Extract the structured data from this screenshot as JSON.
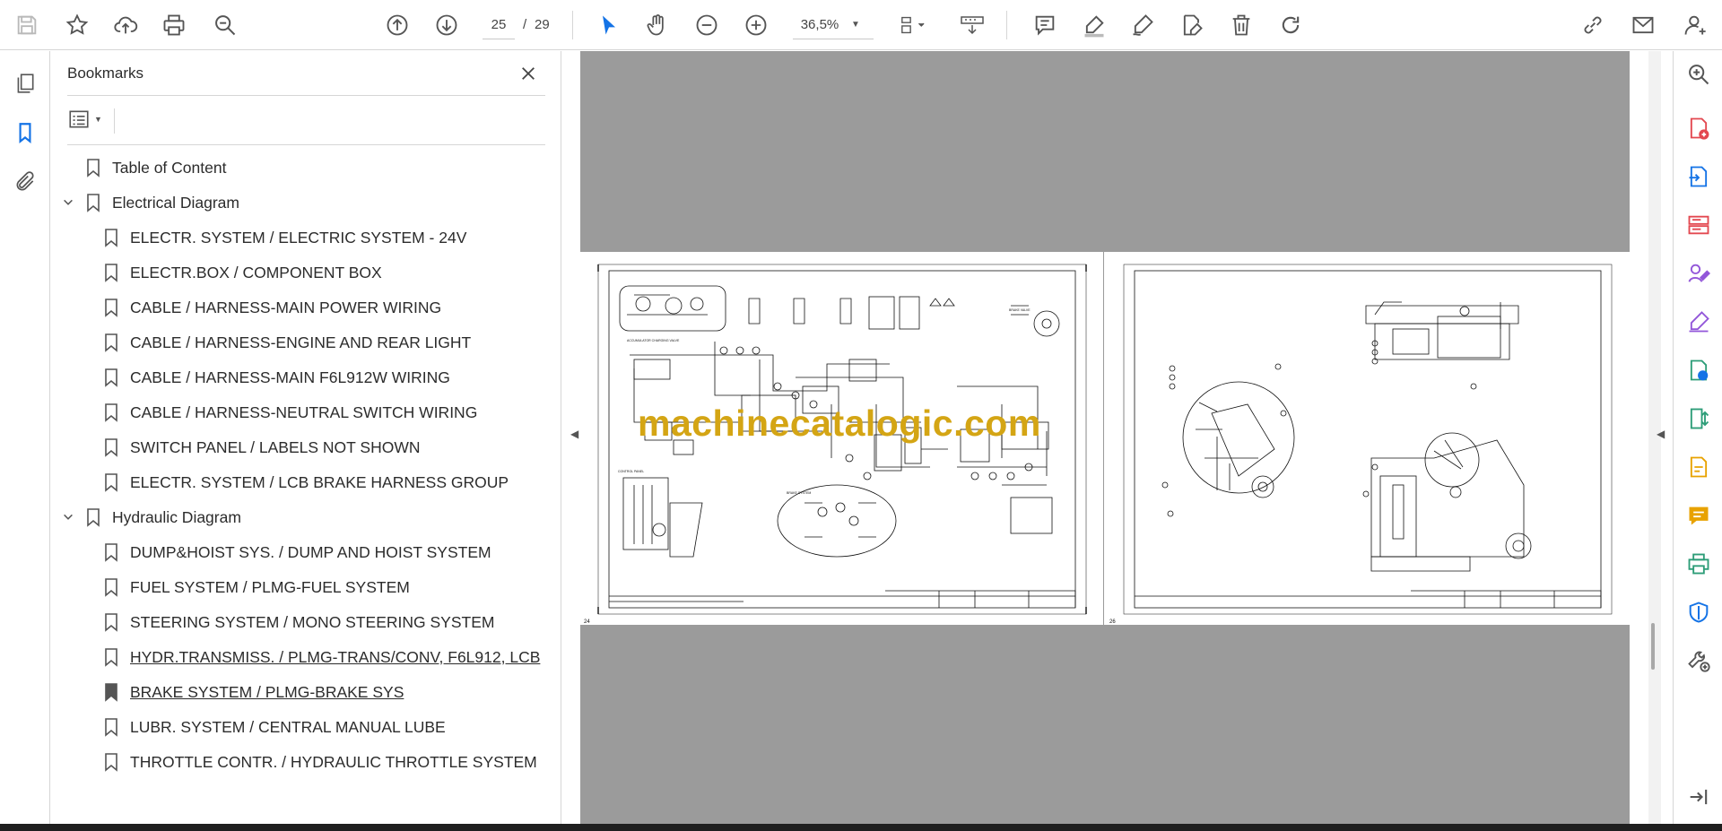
{
  "toolbar": {
    "icons": [
      "save-icon",
      "star-icon",
      "upload-icon",
      "print-icon",
      "search-zoom-icon",
      "arrow-up-circle-icon",
      "arrow-down-circle-icon",
      "select-cursor-icon",
      "hand-icon",
      "zoom-out-icon",
      "zoom-in-icon",
      "page-fit-icon",
      "scroll-mode-icon",
      "comment-icon",
      "highlighter-icon",
      "draw-icon",
      "edit-text-icon",
      "trash-icon",
      "redo-icon",
      "share-link-icon",
      "email-icon",
      "account-icon"
    ],
    "current_page": "25",
    "page_separator": "/",
    "total_pages": "29",
    "zoom": "36,5%"
  },
  "bookmarks": {
    "title": "Bookmarks",
    "items": [
      {
        "label": "Table of Content",
        "level": 0,
        "expandable": false,
        "visited": false
      },
      {
        "label": "Electrical Diagram",
        "level": 0,
        "expandable": true,
        "expanded": true,
        "visited": false
      },
      {
        "label": "ELECTR. SYSTEM / ELECTRIC SYSTEM - 24V",
        "level": 1,
        "visited": false
      },
      {
        "label": "ELECTR.BOX / COMPONENT BOX",
        "level": 1,
        "visited": false
      },
      {
        "label": "CABLE / HARNESS-MAIN POWER WIRING",
        "level": 1,
        "visited": false
      },
      {
        "label": "CABLE / HARNESS-ENGINE AND REAR LIGHT",
        "level": 1,
        "visited": false
      },
      {
        "label": "CABLE / HARNESS-MAIN F6L912W WIRING",
        "level": 1,
        "visited": false
      },
      {
        "label": "CABLE / HARNESS-NEUTRAL SWITCH WIRING",
        "level": 1,
        "visited": false
      },
      {
        "label": "SWITCH PANEL / LABELS NOT SHOWN",
        "level": 1,
        "visited": false
      },
      {
        "label": "ELECTR. SYSTEM / LCB BRAKE HARNESS GROUP",
        "level": 1,
        "visited": false
      },
      {
        "label": "Hydraulic Diagram",
        "level": 0,
        "expandable": true,
        "expanded": true,
        "visited": false
      },
      {
        "label": "DUMP&HOIST SYS. / DUMP AND HOIST SYSTEM",
        "level": 1,
        "visited": false
      },
      {
        "label": "FUEL SYSTEM / PLMG-FUEL SYSTEM",
        "level": 1,
        "visited": false
      },
      {
        "label": "STEERING SYSTEM / MONO STEERING SYSTEM",
        "level": 1,
        "visited": false
      },
      {
        "label": "HYDR.TRANSMISS. / PLMG-TRANS/CONV, F6L912, LCB",
        "level": 1,
        "visited": true
      },
      {
        "label": "BRAKE SYSTEM / PLMG-BRAKE SYS",
        "level": 1,
        "visited": true,
        "filled_icon": true
      },
      {
        "label": "LUBR. SYSTEM / CENTRAL MANUAL LUBE",
        "level": 1,
        "visited": false
      },
      {
        "label": "THROTTLE CONTR. / HYDRAULIC THROTTLE SYSTEM",
        "level": 1,
        "visited": false
      }
    ]
  },
  "document": {
    "watermark": "machinecatalogic.com",
    "left_page_number": "24",
    "right_page_number": "26",
    "canvas_color": "#9b9b9b"
  },
  "right_tools": [
    "search-zoom-icon",
    "create-pdf-icon",
    "export-pdf-icon",
    "organize-pages-icon",
    "fill-sign-icon",
    "sign-icon",
    "send-review-icon",
    "compress-icon",
    "edit-pdf-icon",
    "comment-tool-icon",
    "print-production-icon",
    "protect-icon",
    "more-tools-icon",
    "collapse-pane-icon"
  ],
  "colors": {
    "accent_blue": "#1473e6",
    "watermark_gold": "#d4a514",
    "red_tool": "#e34850",
    "purple_tool": "#9256d9",
    "yellow_tool": "#e8a200",
    "green_tool": "#2d9d78"
  }
}
